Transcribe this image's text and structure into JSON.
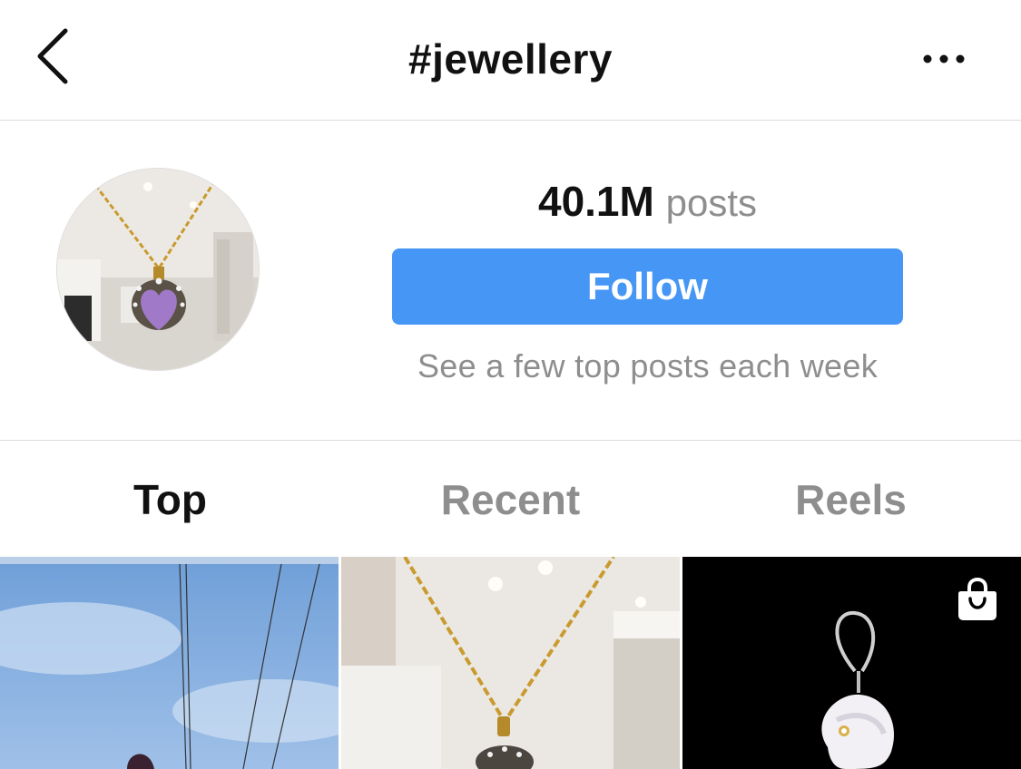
{
  "header": {
    "title": "#jewellery",
    "back_icon": "chevron-left-icon",
    "more_icon": "more-horizontal-icon"
  },
  "profile": {
    "avatar_desc": "necklace-avatar",
    "post_count": "40.1M",
    "post_unit": "posts",
    "follow_label": "Follow",
    "subtext": "See a few top posts each week"
  },
  "tabs": [
    {
      "label": "Top",
      "active": true
    },
    {
      "label": "Recent",
      "active": false
    },
    {
      "label": "Reels",
      "active": false
    }
  ],
  "grid": {
    "shop_icon": "shopping-bag-icon"
  },
  "colors": {
    "accent": "#4596f5",
    "muted": "#8e8e8e",
    "divider": "#dbdbdb"
  }
}
